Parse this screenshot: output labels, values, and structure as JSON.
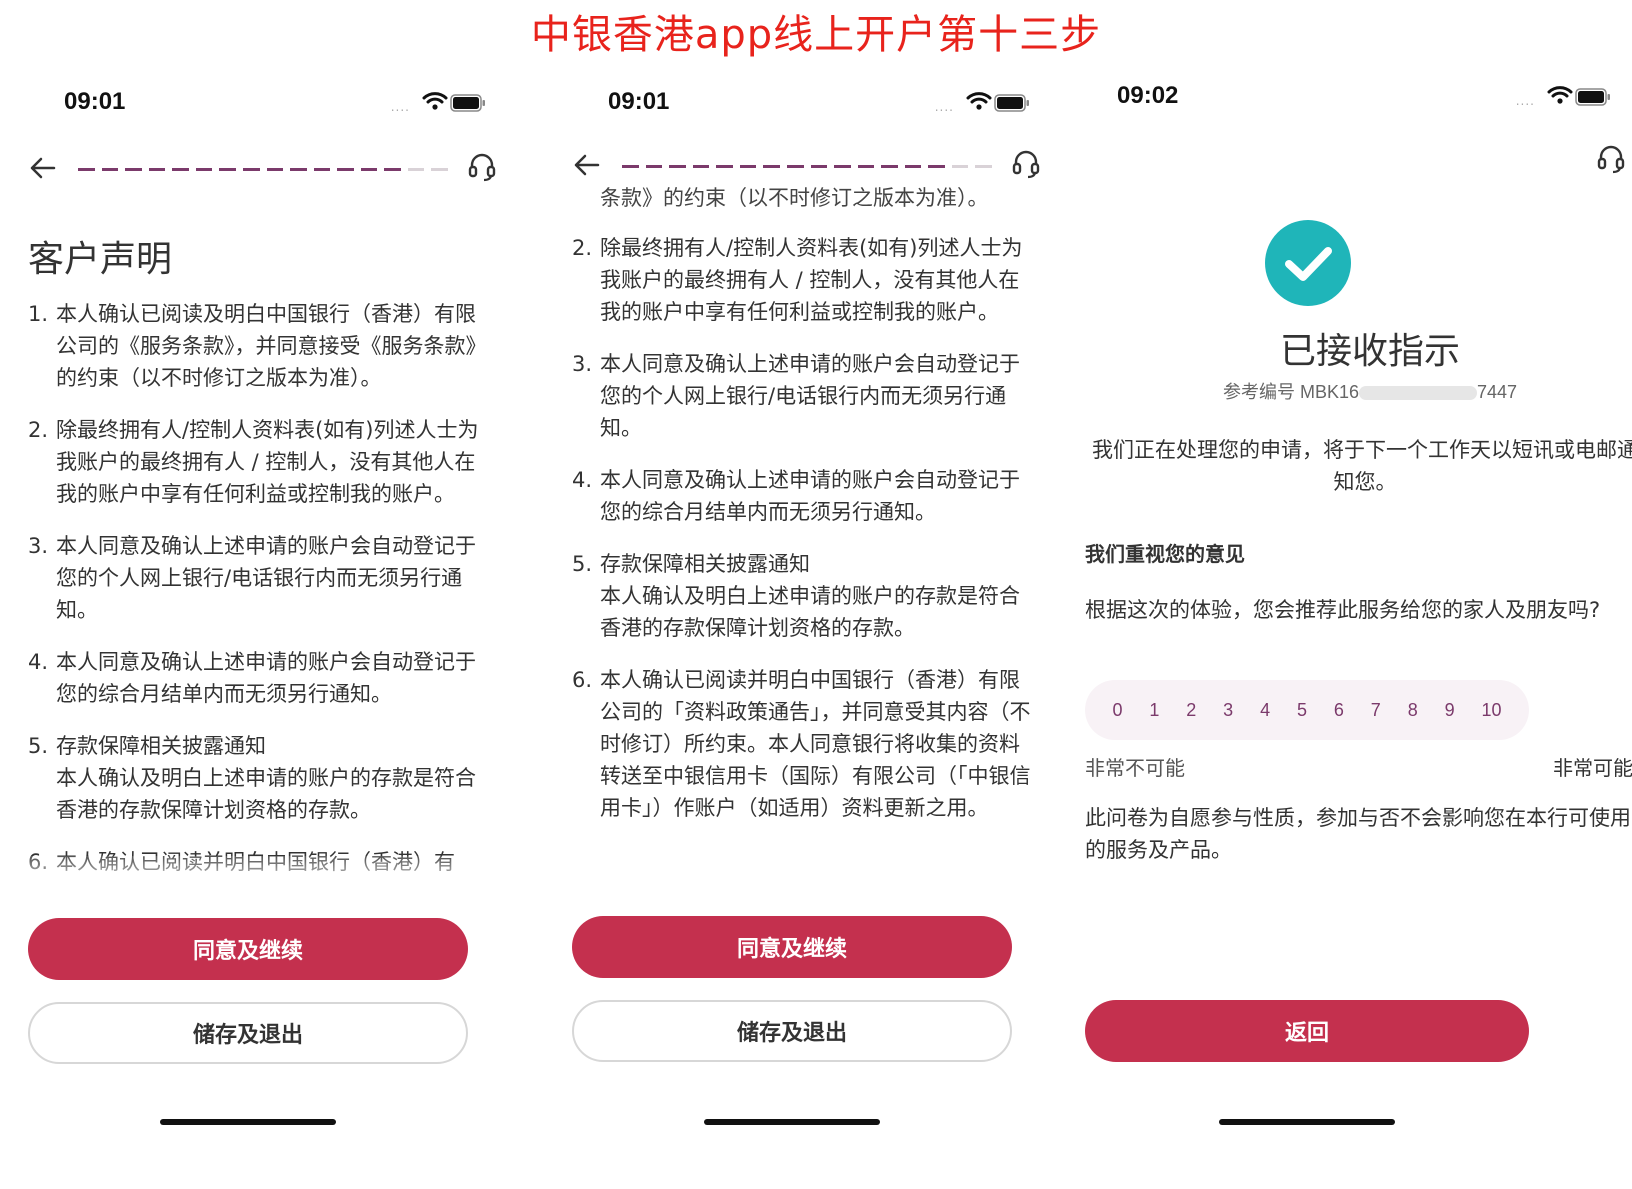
{
  "header": {
    "title": "中银香港app线上开户第十三步"
  },
  "screen1": {
    "time": "09:01",
    "signal": "....",
    "progress_total": 16,
    "progress_done": 14,
    "title": "客户声明",
    "items": [
      {
        "num": "1.",
        "text": "本人确认已阅读及明白中国银行（香港）有限公司的《服务条款》，并同意接受《服务条款》的约束（以不时修订之版本为准）。"
      },
      {
        "num": "2.",
        "text": "除最终拥有人/控制人资料表(如有)列述人士为我账户的最终拥有人 / 控制人，没有其他人在我的账户中享有任何利益或控制我的账户。"
      },
      {
        "num": "3.",
        "text": "本人同意及确认上述申请的账户会自动登记于您的个人网上银行/电话银行内而无须另行通知。"
      },
      {
        "num": "4.",
        "text": "本人同意及确认上述申请的账户会自动登记于您的综合月结单内而无须另行通知。"
      },
      {
        "num": "5.",
        "text": "存款保障相关披露通知",
        "text2": "本人确认及明白上述申请的账户的存款是符合香港的存款保障计划资格的存款。"
      },
      {
        "num": "6.",
        "text": "本人确认已阅读并明白中国银行（香港）有"
      }
    ],
    "primary_button": "同意及继续",
    "secondary_button": "储存及退出"
  },
  "screen2": {
    "time": "09:01",
    "signal": "....",
    "progress_total": 16,
    "progress_done": 14,
    "partial_top": "条款》的约束（以不时修订之版本为准）。",
    "items": [
      {
        "num": "2.",
        "text": "除最终拥有人/控制人资料表(如有)列述人士为我账户的最终拥有人 / 控制人，没有其他人在我的账户中享有任何利益或控制我的账户。"
      },
      {
        "num": "3.",
        "text": "本人同意及确认上述申请的账户会自动登记于您的个人网上银行/电话银行内而无须另行通知。"
      },
      {
        "num": "4.",
        "text": "本人同意及确认上述申请的账户会自动登记于您的综合月结单内而无须另行通知。"
      },
      {
        "num": "5.",
        "text": "存款保障相关披露通知",
        "text2": "本人确认及明白上述申请的账户的存款是符合香港的存款保障计划资格的存款。"
      },
      {
        "num": "6.",
        "text": "本人确认已阅读并明白中国银行（香港）有限公司的「资料政策通告」，并同意受其内容（不时修订）所约束。本人同意银行将收集的资料转送至中银信用卡（国际）有限公司（「中银信用卡」）作账户（如适用）资料更新之用。"
      }
    ],
    "primary_button": "同意及继续",
    "secondary_button": "储存及退出"
  },
  "screen3": {
    "time": "09:02",
    "signal": "....",
    "title": "已接收指示",
    "ref_label": "参考编号 MBK16",
    "ref_suffix": "7447",
    "processing_text": "我们正在处理您的申请，将于下一个工作天以短讯或电邮通知您。",
    "feedback_heading": "我们重视您的意见",
    "feedback_question": "根据这次的体验，您会推荐此服务给您的家人及朋友吗?",
    "scale": [
      "0",
      "1",
      "2",
      "3",
      "4",
      "5",
      "6",
      "7",
      "8",
      "9",
      "10"
    ],
    "scale_low": "非常不可能",
    "scale_high": "非常可能",
    "voluntary_text": "此问卷为自愿参与性质，参加与否不会影响您在本行可使用的服务及产品。",
    "back_button": "返回"
  },
  "colors": {
    "accent": "#c4304e",
    "progress": "#7b3a6b",
    "success": "#1fb5b9",
    "title_red": "#e8231c"
  }
}
